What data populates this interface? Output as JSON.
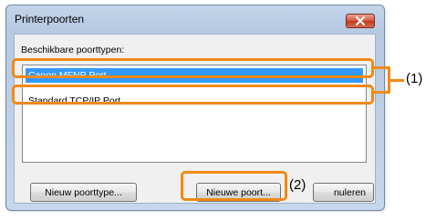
{
  "window": {
    "title": "Printerpoorten"
  },
  "dialog": {
    "types_label": "Beschikbare poorttypen:",
    "port_types": [
      {
        "label": "Canon MFNP Port",
        "selected": true
      },
      {
        "label": "Standard TCP/IP Port",
        "selected": false
      }
    ]
  },
  "buttons": {
    "new_port_type": "Nieuw poorttype...",
    "new_port": "Nieuwe poort...",
    "cancel": "nuleren"
  },
  "callouts": {
    "label_1": "(1)",
    "label_2": "(2)",
    "color": "#f18a14"
  },
  "colors": {
    "selection": "#3399ff",
    "close_button": "#c2371c",
    "window_frame": "#b6c9e2"
  }
}
